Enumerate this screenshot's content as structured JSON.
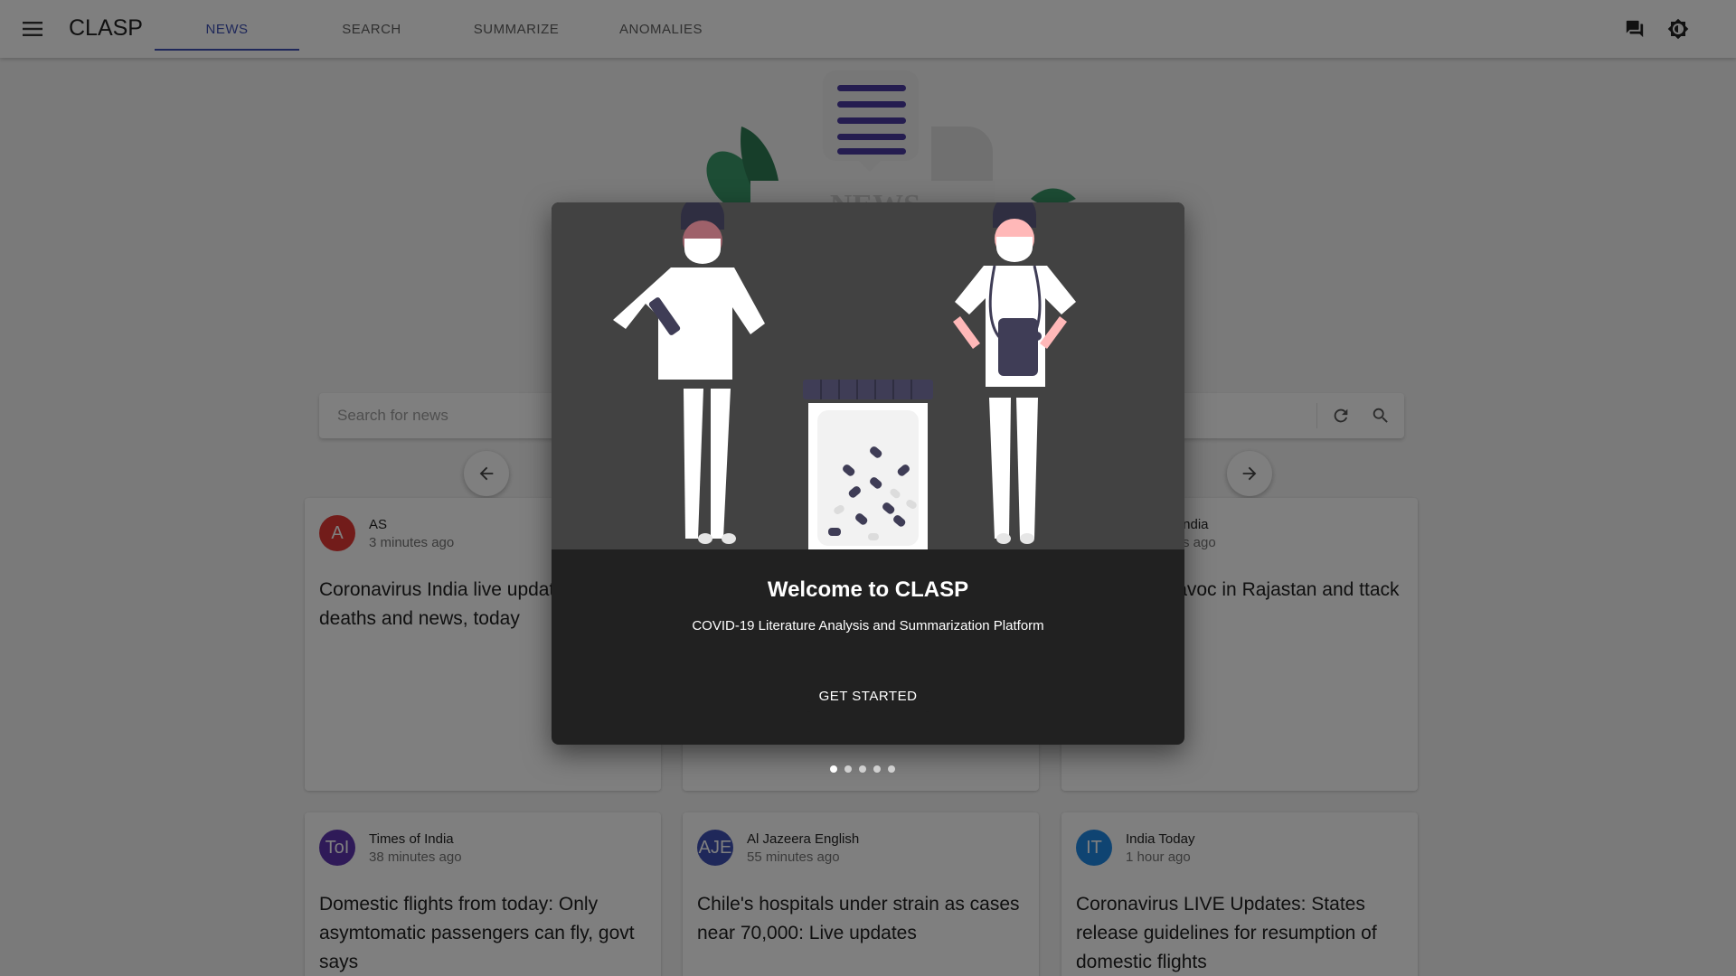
{
  "header": {
    "brand": "CLASP",
    "tabs": [
      {
        "label": "NEWS",
        "active": true
      },
      {
        "label": "SEARCH",
        "active": false
      },
      {
        "label": "SUMMARIZE",
        "active": false
      },
      {
        "label": "ANOMALIES",
        "active": false
      }
    ],
    "icons": [
      "menu-icon",
      "chat-icon",
      "brightness-icon"
    ]
  },
  "hero": {
    "sign_text": "NEWS"
  },
  "search": {
    "placeholder": "Search for news",
    "value": ""
  },
  "cards": [
    {
      "initials": "A",
      "avatar_color": "#e53935",
      "source": "AS",
      "time": "3 minutes ago",
      "headline": "Coronavirus India live updates: cases, deaths and news, today"
    },
    {
      "initials": "",
      "avatar_color": "#5e35b1",
      "source": "",
      "time": "",
      "headline": ""
    },
    {
      "initials": "",
      "avatar_color": "#1e88e5",
      "source": "India",
      "time": "s ago",
      "headline": "g havoc in Rajastan and ttack UP"
    },
    {
      "initials": "ToI",
      "avatar_color": "#5e35b1",
      "source": "Times of India",
      "time": "38 minutes ago",
      "headline": "Domestic flights from today: Only asymtomatic passengers can fly, govt says"
    },
    {
      "initials": "AJE",
      "avatar_color": "#3f51b5",
      "source": "Al Jazeera English",
      "time": "55 minutes ago",
      "headline": "Chile's hospitals under strain as cases near 70,000: Live updates"
    },
    {
      "initials": "IT",
      "avatar_color": "#1e88e5",
      "source": "India Today",
      "time": "1 hour ago",
      "headline": "Coronavirus LIVE Updates: States release guidelines for resumption of domestic flights"
    }
  ],
  "modal": {
    "title": "Welcome to CLASP",
    "subtitle": "COVID-19 Literature Analysis and Summarization Platform",
    "button": "GET STARTED",
    "slides": 5,
    "active_slide": 0
  },
  "colors": {
    "accent": "#3f51b5",
    "modal_bg": "#212121",
    "illustration_bg": "#424242",
    "illustration_accent": "#3f3d56",
    "skin": "#ffb8b8"
  }
}
